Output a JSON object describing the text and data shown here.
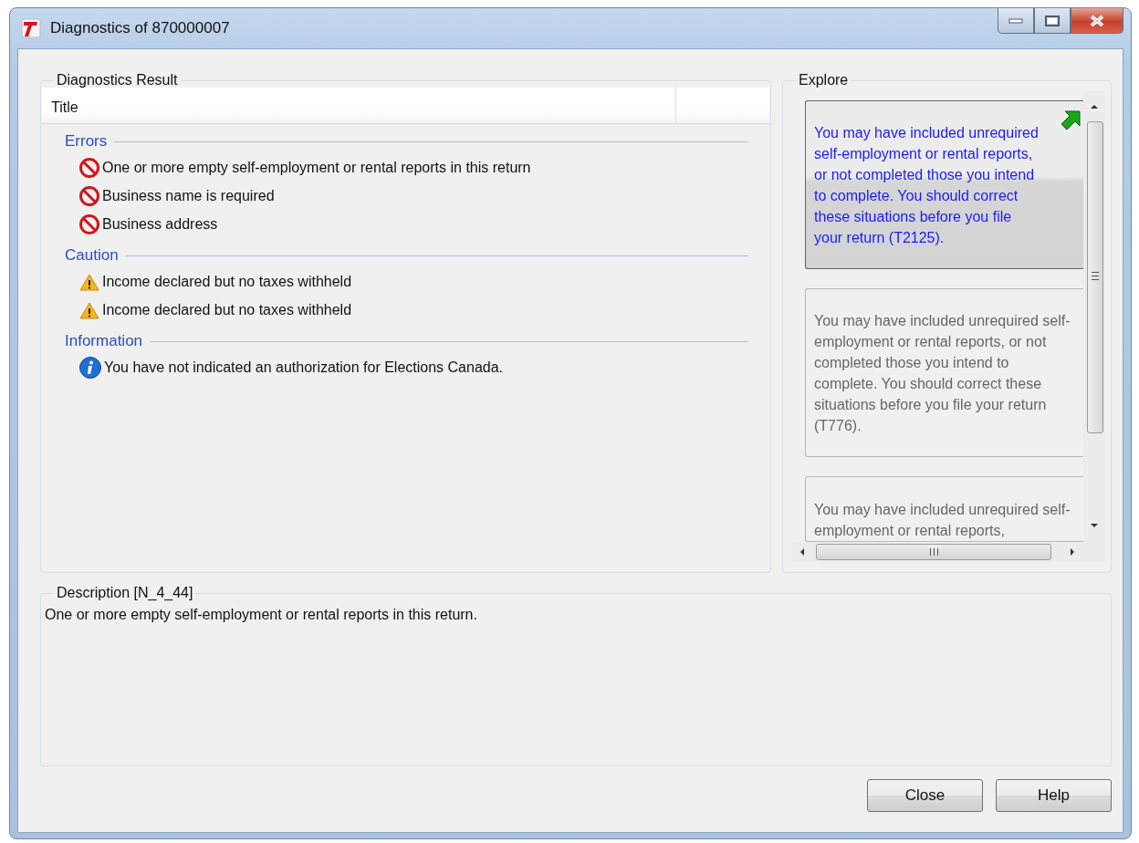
{
  "window": {
    "title": "Diagnostics of 870000007",
    "controls": [
      {
        "kind": "minimize"
      },
      {
        "kind": "maximize"
      },
      {
        "kind": "close"
      }
    ]
  },
  "diagnostics_result": {
    "legend": "Diagnostics Result",
    "columns": [
      "Title"
    ],
    "groups": [
      {
        "kind": "error",
        "label": "Errors",
        "items": [
          "One or more empty self-employment or rental reports in this return",
          "Business name is required",
          "Business address"
        ]
      },
      {
        "kind": "warning",
        "label": "Caution",
        "items": [
          "Income declared but no taxes withheld",
          "Income declared but no taxes withheld"
        ]
      },
      {
        "kind": "info",
        "label": "Information",
        "items": [
          "You have not indicated an authorization for Elections Canada."
        ]
      }
    ]
  },
  "explore": {
    "legend": "Explore",
    "cards": [
      {
        "text": "You may have included unrequired self-employment or rental reports, or not completed those you intend to complete. You should correct these situations before you file your return (T2125).",
        "selected": true
      },
      {
        "text": "You may have included unrequired self-employment or rental reports, or not completed those you intend to complete.  You should correct these situations before you file your return (T776).",
        "selected": false
      },
      {
        "text": "You may have included unrequired self-employment or rental reports,",
        "selected": false
      }
    ]
  },
  "description": {
    "legend": "Description [N_4_44]",
    "text": "One or more empty self-employment or rental reports in this return."
  },
  "buttons": [
    "Close",
    "Help"
  ]
}
